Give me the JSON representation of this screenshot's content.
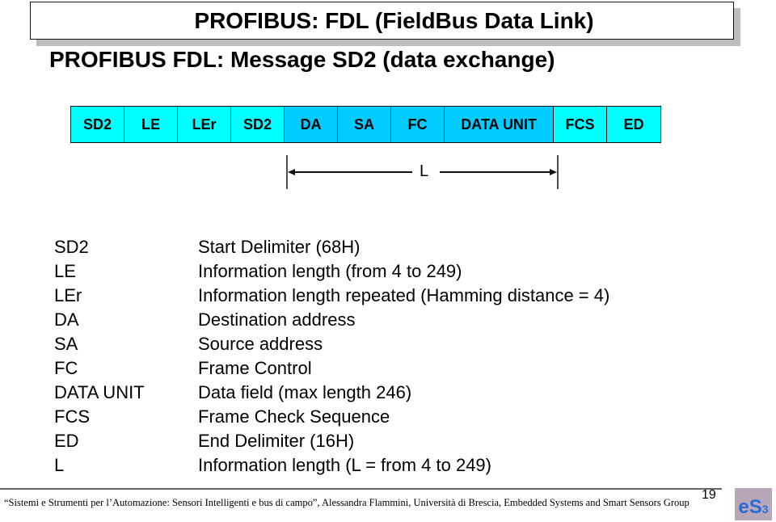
{
  "header": {
    "title": "PROFIBUS: FDL (FieldBus Data Link)",
    "subtitle": "PROFIBUS FDL: Message SD2 (data exchange)"
  },
  "colors": {
    "light_cyan": "#00ffff",
    "medium_cyan": "#00ccff",
    "logo_bg": "#b7a7b9",
    "logo_text": "#2a6ad9",
    "title_shadow": "#bdbdbd"
  },
  "frame": {
    "cells": [
      {
        "label": "SD2",
        "color": "#00ffff"
      },
      {
        "label": "LE",
        "color": "#00ffff"
      },
      {
        "label": "LEr",
        "color": "#00ffff"
      },
      {
        "label": "SD2",
        "color": "#00ffff"
      },
      {
        "label": "DA",
        "color": "#00ccff"
      },
      {
        "label": "SA",
        "color": "#00ccff"
      },
      {
        "label": "FC",
        "color": "#00ccff"
      },
      {
        "label": "DATA UNIT",
        "color": "#00ccff"
      },
      {
        "label": "FCS",
        "color": "#00ffff"
      },
      {
        "label": "ED",
        "color": "#00ffff"
      }
    ],
    "length_label": "L"
  },
  "legend": [
    {
      "key": "SD2",
      "desc": "Start Delimiter (68H)"
    },
    {
      "key": "LE",
      "desc": "Information length (from 4 to 249)"
    },
    {
      "key": "LEr",
      "desc": "Information length repeated (Hamming distance = 4)"
    },
    {
      "key": "DA",
      "desc": "Destination address"
    },
    {
      "key": "SA",
      "desc": "Source address"
    },
    {
      "key": "FC",
      "desc": "Frame Control"
    },
    {
      "key": "DATA UNIT",
      "desc": "Data field (max length 246)"
    },
    {
      "key": "FCS",
      "desc": "Frame Check Sequence"
    },
    {
      "key": "ED",
      "desc": "End Delimiter (16H)"
    },
    {
      "key": "L",
      "desc": "Information length (L = from 4 to 249)"
    }
  ],
  "footer": {
    "text": "“Sistemi e Strumenti per l’Automazione: Sensori Intelligenti e bus di campo”, Alessandra Flammini, Università di Brescia, Embedded Systems and Smart Sensors Group",
    "page_number": "19",
    "logo_text": "eS",
    "logo_sup": "3"
  }
}
